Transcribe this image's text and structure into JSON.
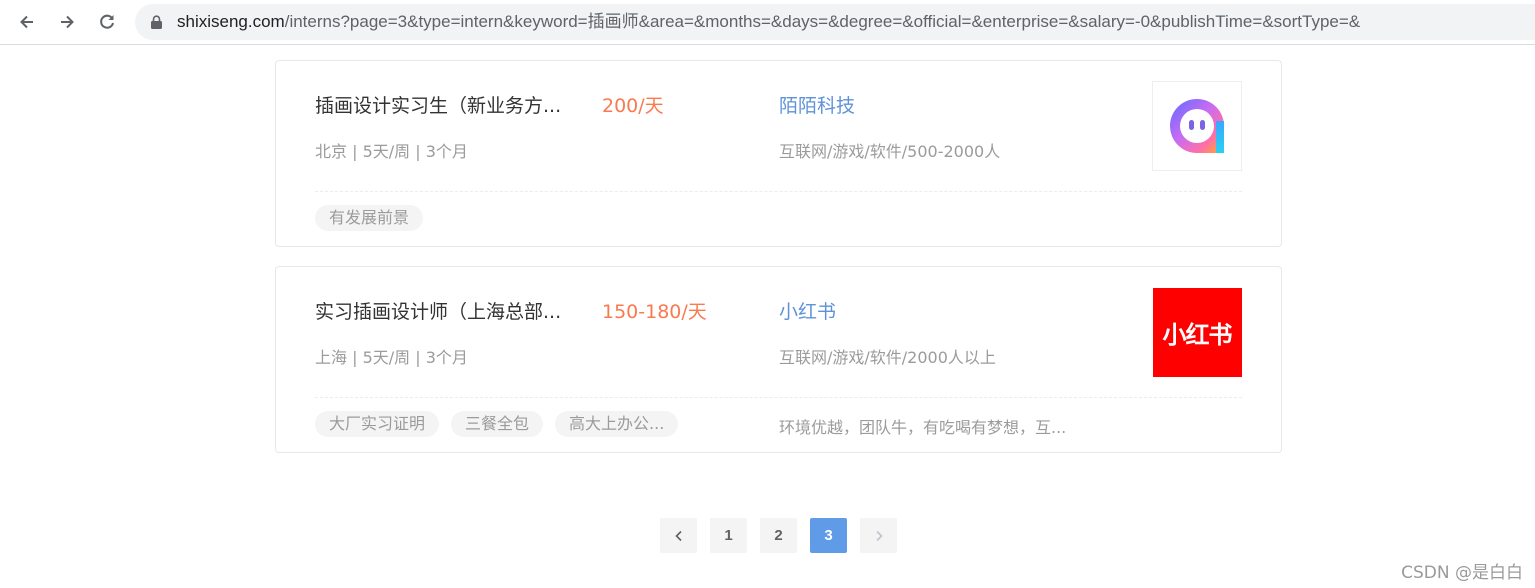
{
  "browser": {
    "url_domain": "shixiseng.com",
    "url_path": "/interns?page=3&type=intern&keyword=插画师&area=&months=&days=&degree=&official=&enterprise=&salary=-0&publishTime=&sortType=&"
  },
  "jobs": [
    {
      "title": "插画设计实习生（新业务方...",
      "salary": "200/天",
      "company": "陌陌科技",
      "meta": "北京 | 5天/周 | 3个月",
      "industry": "互联网/游戏/软件/500-2000人",
      "tags": [
        "有发展前景"
      ],
      "welfare": "",
      "logo_icon": "momo-logo-icon"
    },
    {
      "title": "实习插画设计师（上海总部...",
      "salary": "150-180/天",
      "company": "小红书",
      "meta": "上海 | 5天/周 | 3个月",
      "industry": "互联网/游戏/软件/2000人以上",
      "tags": [
        "大厂实习证明",
        "三餐全包",
        "高大上办公..."
      ],
      "welfare": "环境优越，团队牛，有吃喝有梦想，互...",
      "logo_text": "小红书",
      "logo_icon": "xiaohongshu-logo-icon"
    }
  ],
  "pagination": {
    "prev_icon": "chevron-left-icon",
    "pages": [
      "1",
      "2",
      "3"
    ],
    "current": "3",
    "next_icon": "chevron-right-icon"
  },
  "watermark": "CSDN @是白白",
  "colors": {
    "salary": "#fa7a4f",
    "company": "#5f93d8",
    "active_page": "#5f9be6",
    "xiaohongshu_red": "#ff0000"
  }
}
